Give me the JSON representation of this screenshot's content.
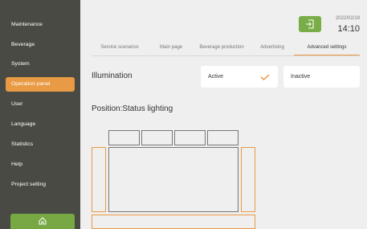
{
  "sidebar": {
    "items": [
      {
        "label": "Maintenance"
      },
      {
        "label": "Beverage"
      },
      {
        "label": "System"
      },
      {
        "label": "Operation panel",
        "active": true
      },
      {
        "label": "User"
      },
      {
        "label": "Language"
      },
      {
        "label": "Statistics"
      },
      {
        "label": "Help"
      },
      {
        "label": "Project setting"
      }
    ],
    "home_icon": "home-icon"
  },
  "header": {
    "date": "2022/02/19",
    "time": "14:10",
    "logout_icon": "logout-icon"
  },
  "tabs": [
    {
      "label": "Service scenarios"
    },
    {
      "label": "Main page"
    },
    {
      "label": "Beverage production"
    },
    {
      "label": "Advertising"
    },
    {
      "label": "Advanced settings",
      "active": true
    }
  ],
  "illumination": {
    "label": "Illumination",
    "active_option": "Active",
    "inactive_option": "Inactive",
    "selected": "Active"
  },
  "position": {
    "label": "Position:Status lighting"
  },
  "colors": {
    "sidebar": "#4a4a44",
    "accent_orange": "#e99a44",
    "accent_green": "#79ad48",
    "background": "#efefef"
  }
}
